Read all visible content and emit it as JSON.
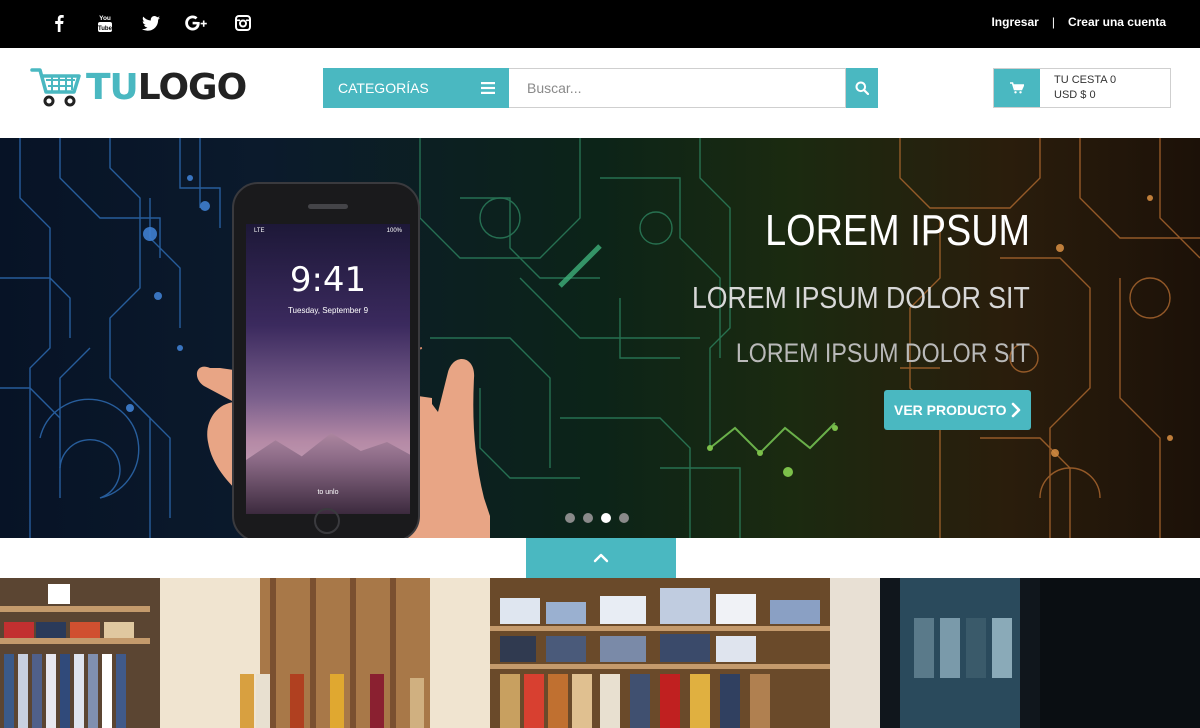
{
  "topbar": {
    "social": [
      {
        "name": "facebook-icon"
      },
      {
        "name": "youtube-icon"
      },
      {
        "name": "twitter-icon"
      },
      {
        "name": "google-plus-icon"
      },
      {
        "name": "instagram-icon"
      }
    ],
    "login_label": "Ingresar",
    "separator": "|",
    "register_label": "Crear una cuenta"
  },
  "header": {
    "logo": {
      "part1": "TU",
      "part2": "LOGO"
    },
    "categories_label": "CATEGORÍAS",
    "search_placeholder": "Buscar...",
    "cart": {
      "line1": "TU CESTA 0",
      "line2": "USD $ 0"
    }
  },
  "hero": {
    "title": "LOREM IPSUM",
    "subtitle": "LOREM IPSUM DOLOR SIT",
    "subtitle2": "LOREM IPSUM DOLOR SIT",
    "cta_label": "VER PRODUCTO",
    "phone": {
      "time": "9:41",
      "date": "Tuesday, September 9",
      "carrier": "LTE",
      "battery": "100%",
      "unlock": "to unlo"
    },
    "slides_count": 4,
    "active_slide": 3
  },
  "colors": {
    "accent": "#4ab8c1",
    "topbar": "#000000",
    "text": "#222222"
  }
}
